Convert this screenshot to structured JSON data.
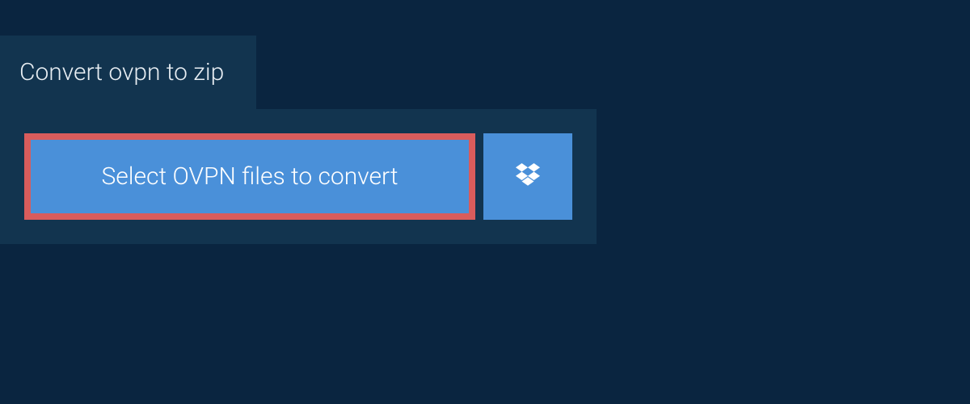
{
  "tab": {
    "title": "Convert ovpn to zip"
  },
  "actions": {
    "select_label": "Select OVPN files to convert"
  },
  "colors": {
    "background": "#0a2540",
    "panel": "#12344f",
    "button": "#4a90d9",
    "highlight_border": "#d95c5c",
    "text_light": "#e8eef3",
    "text_white": "#ffffff"
  }
}
